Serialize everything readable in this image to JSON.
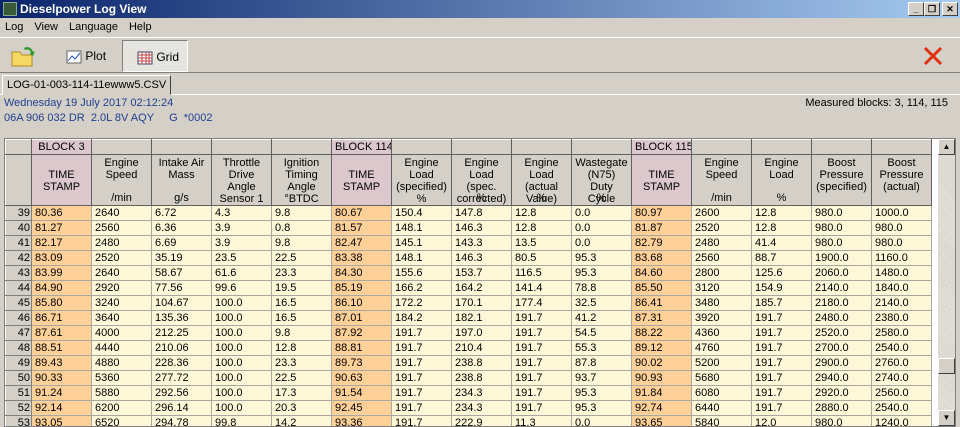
{
  "window": {
    "title": "Dieselpower Log View",
    "min": "_",
    "restore": "❐",
    "close": "✕"
  },
  "menu": [
    "Log",
    "View",
    "Language",
    "Help"
  ],
  "toolbar": {
    "plot": "Plot",
    "grid": "Grid"
  },
  "tab": "LOG-01-003-114-11ewww5.CSV",
  "info": {
    "date": "Wednesday 19 July 2017 02:12:24",
    "ecu": "06A 906 032 DR  2.0L 8V AQY     G  *0002",
    "measured": "Measured blocks: 3, 114, 115"
  },
  "blocks": [
    "BLOCK 3",
    "",
    "",
    "",
    "",
    "BLOCK 114",
    "",
    "",
    "",
    "",
    "BLOCK 115",
    "",
    "",
    "",
    ""
  ],
  "columns": [
    {
      "label": "TIME STAMP",
      "unit": "",
      "ts": true
    },
    {
      "label": "Engine Speed",
      "unit": "/min"
    },
    {
      "label": "Intake Air Mass",
      "unit": "g/s"
    },
    {
      "label": "Throttle Drive Angle Sensor 1",
      "unit": ""
    },
    {
      "label": "Ignition Timing Angle °BTDC",
      "unit": ""
    },
    {
      "label": "TIME STAMP",
      "unit": "",
      "ts": true
    },
    {
      "label": "Engine Load (specified) %",
      "unit": ""
    },
    {
      "label": "Engine Load (spec. corrected)",
      "unit": "%"
    },
    {
      "label": "Engine Load (actual Value)",
      "unit": "%"
    },
    {
      "label": "Wastegate (N75) Duty Cycle",
      "unit": "%"
    },
    {
      "label": "TIME STAMP",
      "unit": "",
      "ts": true
    },
    {
      "label": "Engine Speed",
      "unit": "/min"
    },
    {
      "label": "Engine Load",
      "unit": "%"
    },
    {
      "label": "Boost Pressure (specified)",
      "unit": ""
    },
    {
      "label": "Boost Pressure (actual)",
      "unit": ""
    }
  ],
  "rows": [
    [
      "39",
      "80.36",
      "2640",
      "6.72",
      "4.3",
      "9.8",
      "80.67",
      "150.4",
      "147.8",
      "12.8",
      "0.0",
      "80.97",
      "2600",
      "12.8",
      "980.0",
      "1000.0"
    ],
    [
      "40",
      "81.27",
      "2560",
      "6.36",
      "3.9",
      "0.8",
      "81.57",
      "148.1",
      "146.3",
      "12.8",
      "0.0",
      "81.87",
      "2520",
      "12.8",
      "980.0",
      "980.0"
    ],
    [
      "41",
      "82.17",
      "2480",
      "6.69",
      "3.9",
      "9.8",
      "82.47",
      "145.1",
      "143.3",
      "13.5",
      "0.0",
      "82.79",
      "2480",
      "41.4",
      "980.0",
      "980.0"
    ],
    [
      "42",
      "83.09",
      "2520",
      "35.19",
      "23.5",
      "22.5",
      "83.38",
      "148.1",
      "146.3",
      "80.5",
      "95.3",
      "83.68",
      "2560",
      "88.7",
      "1900.0",
      "1160.0"
    ],
    [
      "43",
      "83.99",
      "2640",
      "58.67",
      "61.6",
      "23.3",
      "84.30",
      "155.6",
      "153.7",
      "116.5",
      "95.3",
      "84.60",
      "2800",
      "125.6",
      "2060.0",
      "1480.0"
    ],
    [
      "44",
      "84.90",
      "2920",
      "77.56",
      "99.6",
      "19.5",
      "85.19",
      "166.2",
      "164.2",
      "141.4",
      "78.8",
      "85.50",
      "3120",
      "154.9",
      "2140.0",
      "1840.0"
    ],
    [
      "45",
      "85.80",
      "3240",
      "104.67",
      "100.0",
      "16.5",
      "86.10",
      "172.2",
      "170.1",
      "177.4",
      "32.5",
      "86.41",
      "3480",
      "185.7",
      "2180.0",
      "2140.0"
    ],
    [
      "46",
      "86.71",
      "3640",
      "135.36",
      "100.0",
      "16.5",
      "87.01",
      "184.2",
      "182.1",
      "191.7",
      "41.2",
      "87.31",
      "3920",
      "191.7",
      "2480.0",
      "2380.0"
    ],
    [
      "47",
      "87.61",
      "4000",
      "212.25",
      "100.0",
      "9.8",
      "87.92",
      "191.7",
      "197.0",
      "191.7",
      "54.5",
      "88.22",
      "4360",
      "191.7",
      "2520.0",
      "2580.0"
    ],
    [
      "48",
      "88.51",
      "4440",
      "210.06",
      "100.0",
      "12.8",
      "88.81",
      "191.7",
      "210.4",
      "191.7",
      "55.3",
      "89.12",
      "4760",
      "191.7",
      "2700.0",
      "2540.0"
    ],
    [
      "49",
      "89.43",
      "4880",
      "228.36",
      "100.0",
      "23.3",
      "89.73",
      "191.7",
      "238.8",
      "191.7",
      "87.8",
      "90.02",
      "5200",
      "191.7",
      "2900.0",
      "2760.0"
    ],
    [
      "50",
      "90.33",
      "5360",
      "277.72",
      "100.0",
      "22.5",
      "90.63",
      "191.7",
      "238.8",
      "191.7",
      "93.7",
      "90.93",
      "5680",
      "191.7",
      "2940.0",
      "2740.0"
    ],
    [
      "51",
      "91.24",
      "5880",
      "292.56",
      "100.0",
      "17.3",
      "91.54",
      "191.7",
      "234.3",
      "191.7",
      "95.3",
      "91.84",
      "6080",
      "191.7",
      "2920.0",
      "2560.0"
    ],
    [
      "52",
      "92.14",
      "6200",
      "296.14",
      "100.0",
      "20.3",
      "92.45",
      "191.7",
      "234.3",
      "191.7",
      "95.3",
      "92.74",
      "6440",
      "191.7",
      "2880.0",
      "2540.0"
    ],
    [
      "53",
      "93.05",
      "6520",
      "294.78",
      "99.8",
      "14.2",
      "93.36",
      "191.7",
      "222.9",
      "11.3",
      "0.0",
      "93.65",
      "5840",
      "12.0",
      "980.0",
      "1240.0"
    ]
  ]
}
